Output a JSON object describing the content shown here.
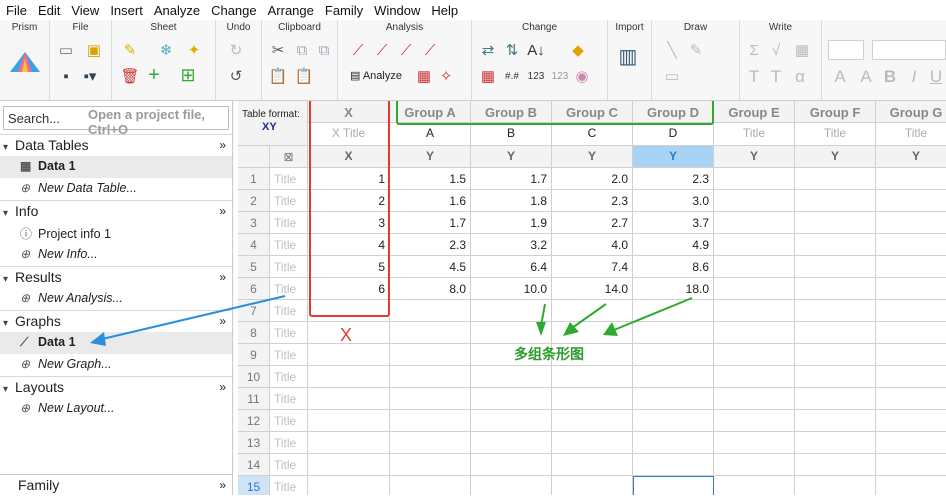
{
  "menu": [
    "File",
    "Edit",
    "View",
    "Insert",
    "Analyze",
    "Change",
    "Arrange",
    "Family",
    "Window",
    "Help"
  ],
  "ribbon": {
    "groups": [
      "Prism",
      "File",
      "Sheet",
      "Undo",
      "Clipboard",
      "Analysis",
      "Change",
      "Import",
      "Draw",
      "Write"
    ],
    "analyze_label": "Analyze"
  },
  "sidebar": {
    "search_placeholder": "Search...",
    "search_hint": "Open a project file, Ctrl+O",
    "sections": [
      {
        "title": "Data Tables",
        "items": [
          {
            "label": "Data 1",
            "icon": "table-icon",
            "selected": true
          },
          {
            "label": "New Data Table...",
            "icon": "add-icon",
            "new": true
          }
        ]
      },
      {
        "title": "Info",
        "items": [
          {
            "label": "Project info 1",
            "icon": "info-icon"
          },
          {
            "label": "New Info...",
            "icon": "add-icon",
            "new": true
          }
        ]
      },
      {
        "title": "Results",
        "items": [
          {
            "label": "New Analysis...",
            "icon": "add-icon",
            "new": true
          }
        ]
      },
      {
        "title": "Graphs",
        "items": [
          {
            "label": "Data 1",
            "icon": "graph-icon",
            "selected": true
          },
          {
            "label": "New Graph...",
            "icon": "add-icon",
            "new": true
          }
        ]
      },
      {
        "title": "Layouts",
        "items": [
          {
            "label": "New Layout...",
            "icon": "add-icon",
            "new": true
          }
        ]
      }
    ],
    "footer": "Family"
  },
  "table": {
    "format_label": "Table format:",
    "format_value": "XY",
    "x_header": "X",
    "x_title": "X Title",
    "x_sub": "X",
    "groups": [
      {
        "name": "Group A",
        "letter": "A",
        "sub": "Y"
      },
      {
        "name": "Group B",
        "letter": "B",
        "sub": "Y"
      },
      {
        "name": "Group C",
        "letter": "C",
        "sub": "Y"
      },
      {
        "name": "Group D",
        "letter": "D",
        "sub": "Y"
      },
      {
        "name": "Group E",
        "letter": "Title",
        "sub": "Y"
      },
      {
        "name": "Group F",
        "letter": "Title",
        "sub": "Y"
      },
      {
        "name": "Group G",
        "letter": "Title",
        "sub": "Y"
      }
    ],
    "row_title": "Title",
    "rows": [
      {
        "n": "1",
        "x": "1",
        "v": [
          "1.5",
          "1.7",
          "2.0",
          "2.3"
        ]
      },
      {
        "n": "2",
        "x": "2",
        "v": [
          "1.6",
          "1.8",
          "2.3",
          "3.0"
        ]
      },
      {
        "n": "3",
        "x": "3",
        "v": [
          "1.7",
          "1.9",
          "2.7",
          "3.7"
        ]
      },
      {
        "n": "4",
        "x": "4",
        "v": [
          "2.3",
          "3.2",
          "4.0",
          "4.9"
        ]
      },
      {
        "n": "5",
        "x": "5",
        "v": [
          "4.5",
          "6.4",
          "7.4",
          "8.6"
        ]
      },
      {
        "n": "6",
        "x": "6",
        "v": [
          "8.0",
          "10.0",
          "14.0",
          "18.0"
        ]
      },
      {
        "n": "7",
        "x": "",
        "v": []
      },
      {
        "n": "8",
        "x": "",
        "v": []
      },
      {
        "n": "9",
        "x": "",
        "v": []
      },
      {
        "n": "10",
        "x": "",
        "v": []
      },
      {
        "n": "11",
        "x": "",
        "v": []
      },
      {
        "n": "12",
        "x": "",
        "v": []
      },
      {
        "n": "13",
        "x": "",
        "v": []
      },
      {
        "n": "14",
        "x": "",
        "v": []
      },
      {
        "n": "15",
        "x": "",
        "v": []
      }
    ]
  },
  "annotations": {
    "x_label": "X",
    "chinese_label": "多组条形图",
    "red": "#e23b2e",
    "green": "#2faa2f",
    "blue": "#2b8fdc"
  }
}
